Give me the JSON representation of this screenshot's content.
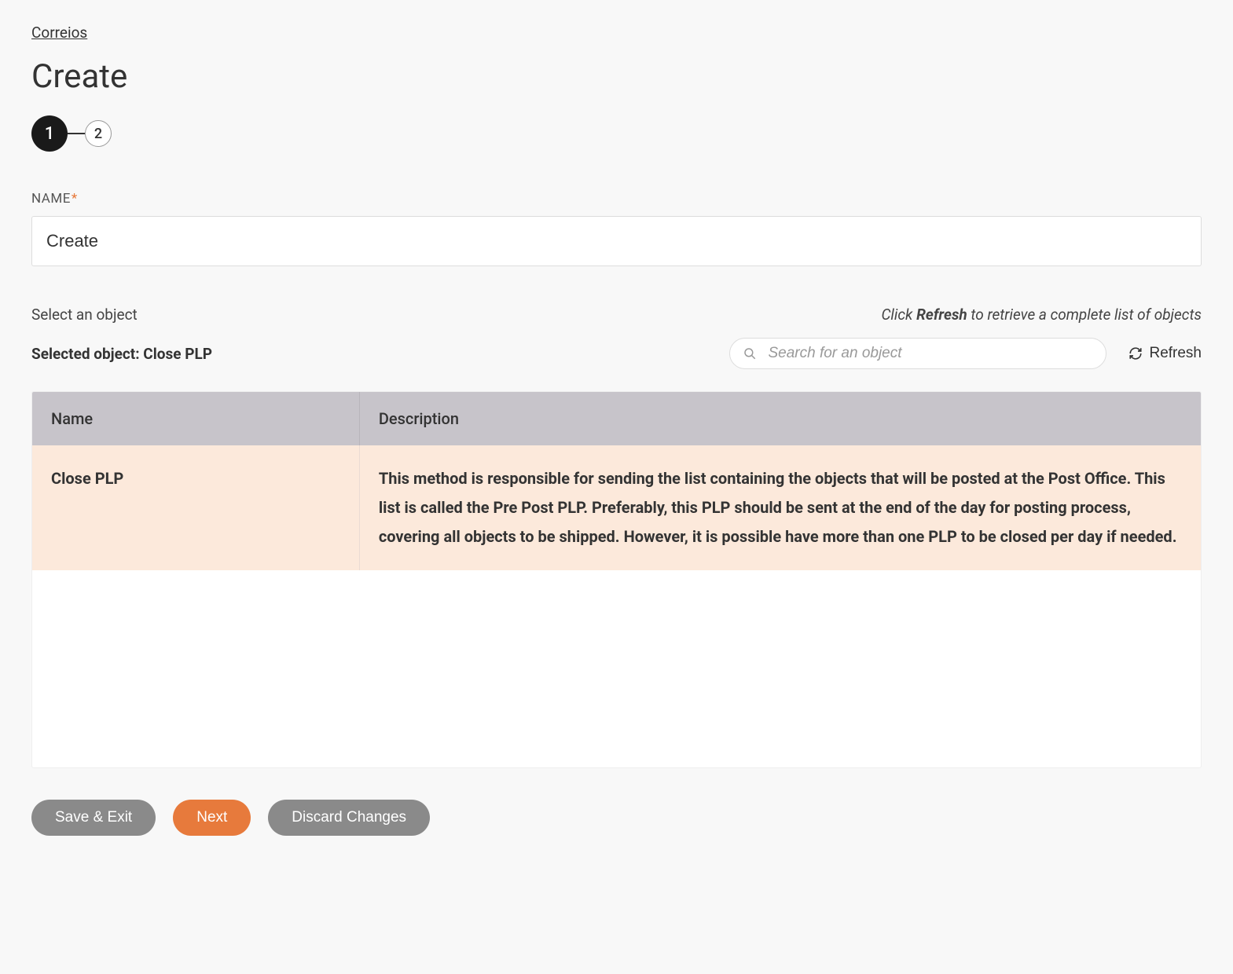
{
  "breadcrumb": "Correios",
  "page_title": "Create",
  "stepper": {
    "step1": "1",
    "step2": "2"
  },
  "name_field": {
    "label": "NAME",
    "value": "Create"
  },
  "object_section": {
    "label": "Select an object",
    "hint_prefix": "Click ",
    "hint_bold": "Refresh",
    "hint_suffix": " to retrieve a complete list of objects",
    "selected_prefix": "Selected object: ",
    "selected_value": "Close PLP",
    "search_placeholder": "Search for an object",
    "refresh_label": "Refresh"
  },
  "table": {
    "headers": {
      "name": "Name",
      "description": "Description"
    },
    "rows": [
      {
        "name": "Close PLP",
        "description": "This method is responsible for sending the list containing the objects that will be posted at the Post Office. This list is called the Pre Post PLP. Preferably, this PLP should be sent at the end of the day for posting process, covering all objects to be shipped. However, it is possible have more than one PLP to be closed per day if needed."
      }
    ]
  },
  "buttons": {
    "save_exit": "Save & Exit",
    "next": "Next",
    "discard": "Discard Changes"
  }
}
